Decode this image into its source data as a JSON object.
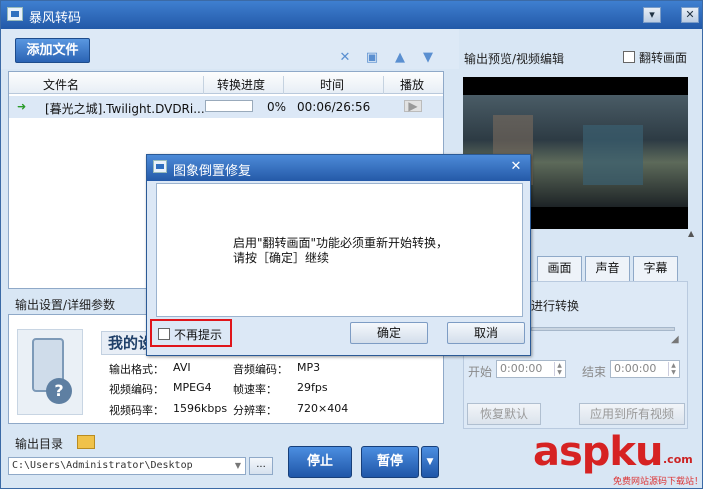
{
  "window": {
    "title": "暴风转码"
  },
  "toolbar": {
    "add_file_label": "添加文件"
  },
  "file_list": {
    "columns": [
      "文件名",
      "转换进度",
      "时间",
      "播放"
    ],
    "rows": [
      {
        "name": "[暮光之城].Twilight.DVDRi...",
        "progress_text": "0%",
        "progress": 0,
        "time": "00:06/26:56"
      }
    ]
  },
  "settings": {
    "label": "输出设置/详细参数",
    "profile_title": "我的设",
    "fields": [
      {
        "k": "输出格式：",
        "v": "AVI"
      },
      {
        "k": "音频编码：",
        "v": "MP3"
      },
      {
        "k": "视频编码：",
        "v": "MPEG4"
      },
      {
        "k": "帧速率：",
        "v": "29fps"
      },
      {
        "k": "视频码率：",
        "v": "1596kbps"
      },
      {
        "k": "分辨率：",
        "v": "720×404"
      }
    ]
  },
  "output": {
    "dir_label": "输出目录",
    "path": "C:\\Users\\Administrator\\Desktop",
    "browse_label": "...",
    "stop_label": "停止",
    "pause_label": "暂停"
  },
  "preview": {
    "label": "输出预览/视频编辑",
    "flip_label": "翻转画面",
    "tabs": [
      "画面",
      "声音",
      "字幕"
    ],
    "hint": "进行转换",
    "start_label": "开始",
    "end_label": "结束",
    "start_time": "0:00:00",
    "end_time": "0:00:00",
    "reset_label": "恢复默认",
    "apply_label": "应用到所有视频"
  },
  "dialog": {
    "title": "图象倒置修复",
    "message_line1": "启用\"翻转画面\"功能必须重新开始转换，",
    "message_line2": "请按［确定］继续",
    "no_remind_label": "不再提示",
    "ok_label": "确定",
    "cancel_label": "取消"
  },
  "watermark": {
    "main": "aspku",
    "suffix": ".com",
    "sub": "免费网站源码下载站！"
  },
  "colors": {
    "accent": "#2a63b4",
    "highlight": "#e0151b",
    "watermark": "#d62222"
  }
}
